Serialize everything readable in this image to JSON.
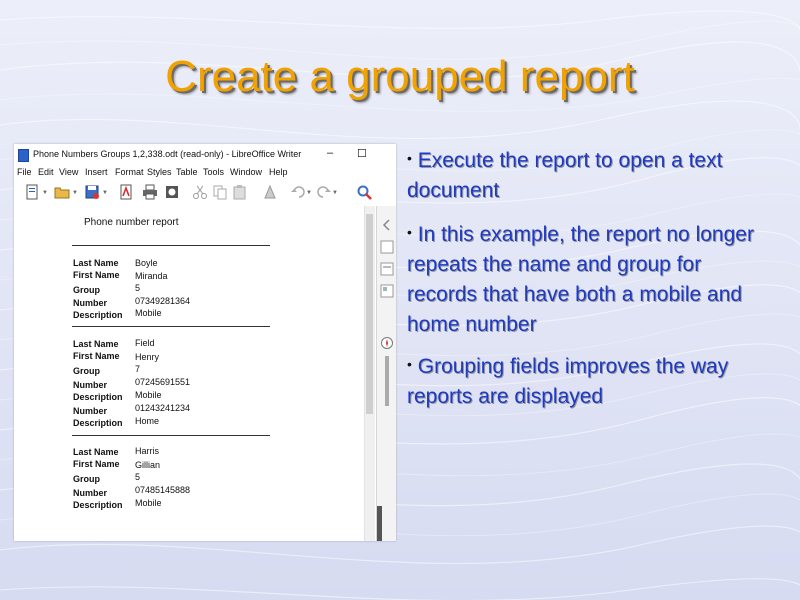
{
  "slide": {
    "title": "Create a grouped report",
    "bullets": [
      "Execute the report to open a text document",
      "In this example, the report no longer repeats the name and group for records that have both a mobile and home number",
      "Grouping fields improves the way reports are displayed"
    ],
    "title_color": "#f2a200",
    "text_color": "#1d39c8"
  },
  "window": {
    "title": "Phone Numbers Groups 1,2,338.odt (read-only) - LibreOffice Writer",
    "buttons": {
      "minimize": "–",
      "maximize": "☐"
    },
    "menu": [
      "File",
      "Edit",
      "View",
      "Insert",
      "Format",
      "Styles",
      "Table",
      "Tools",
      "Window",
      "Help"
    ]
  },
  "toolbar_icons": [
    "new-document-icon",
    "open-folder-icon",
    "save-icon",
    "export-pdf-icon",
    "print-icon",
    "print-preview-icon",
    "cut-icon",
    "copy-icon",
    "paste-icon",
    "clone-formatting-icon",
    "undo-icon",
    "redo-icon",
    "find-replace-icon"
  ],
  "report": {
    "heading": "Phone number report",
    "labels": {
      "last_name": "Last Name",
      "first_name": "First Name",
      "group": "Group",
      "number": "Number",
      "description": "Description"
    },
    "records": [
      {
        "last_name": "Boyle",
        "first_name": "Miranda",
        "group": "5",
        "numbers": [
          {
            "number": "07349281364",
            "description": "Mobile"
          }
        ]
      },
      {
        "last_name": "Field",
        "first_name": "Henry",
        "group": "7",
        "numbers": [
          {
            "number": "07245691551",
            "description": "Mobile"
          },
          {
            "number": "01243241234",
            "description": "Home"
          }
        ]
      },
      {
        "last_name": "Harris",
        "first_name": "Gillian",
        "group": "5",
        "numbers": [
          {
            "number": "07485145888",
            "description": "Mobile"
          }
        ]
      }
    ]
  }
}
